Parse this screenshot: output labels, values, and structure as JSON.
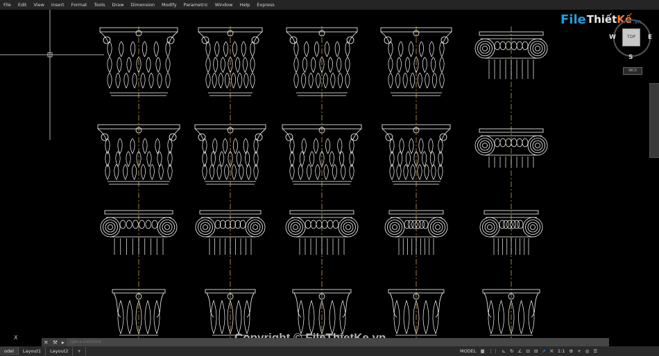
{
  "menu": [
    "File",
    "Edit",
    "View",
    "Insert",
    "Format",
    "Tools",
    "Draw",
    "Dimension",
    "Modify",
    "Parametric",
    "Window",
    "Help",
    "Express"
  ],
  "logo": {
    "file": "File",
    "thiet": "Thiết",
    "ke": "Kế",
    "vn": ".vn"
  },
  "viewcube": {
    "top": "TOP",
    "w": "W",
    "e": "E",
    "s": "S",
    "wcs": "WCS"
  },
  "ucs_x": "X",
  "watermark": "Copyright © FileThietKe.vn",
  "command": {
    "placeholder": "Type a command"
  },
  "tabs": [
    "odel",
    "Layout1",
    "Layout2",
    "+"
  ],
  "status": [
    "MODEL",
    "▦",
    "⋮⋮",
    "⊾",
    "↻",
    "∠",
    "⊡",
    "⊟",
    "⇗",
    "⨉",
    "1:1",
    "⚙",
    "+",
    "◎",
    "☰"
  ],
  "colors": {
    "line": "#ffffff",
    "centerline": "#c8a050",
    "crosshair": "#e0e0e0"
  }
}
